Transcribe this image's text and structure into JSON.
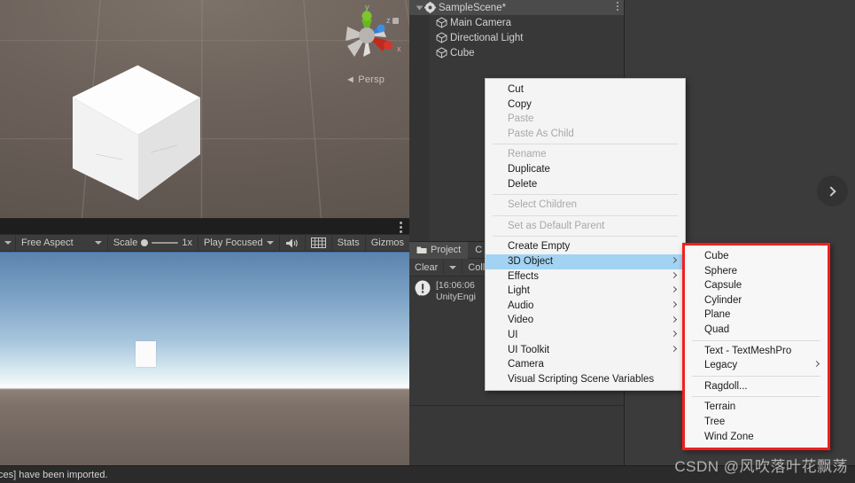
{
  "scene_view": {
    "gizmo_label": "Persp",
    "axis_x": "x",
    "axis_y": "y",
    "axis_z": "z",
    "object_name": "Cube"
  },
  "game_toolbar": {
    "aspect": "Free Aspect",
    "scale_label": "Scale",
    "scale_value": "1x",
    "play_mode": "Play Focused",
    "stats": "Stats",
    "gizmos": "Gizmos",
    "mute_icon": "speaker-icon",
    "gizmo_icon": "grid-icon",
    "menu_icon": "kebab-icon"
  },
  "hierarchy": {
    "scene_name": "SampleScene*",
    "items": [
      {
        "label": "Main Camera",
        "icon": "gameobject-icon"
      },
      {
        "label": "Directional Light",
        "icon": "gameobject-icon"
      },
      {
        "label": "Cube",
        "icon": "gameobject-icon"
      }
    ]
  },
  "project_panel": {
    "tabs": [
      {
        "label": "Project",
        "icon": "folder-icon",
        "active": true
      },
      {
        "label": "C",
        "icon": "console-icon",
        "active": false
      }
    ],
    "console_buttons": [
      "Clear",
      "Collapse"
    ],
    "log": {
      "timestamp": "[16:06:06",
      "message": "UnityEngi"
    }
  },
  "inspector": {
    "collapse_icon": "chevron-right-icon"
  },
  "context_menu": {
    "items": [
      {
        "label": "Cut",
        "disabled": false,
        "submenu": false
      },
      {
        "label": "Copy",
        "disabled": false,
        "submenu": false
      },
      {
        "label": "Paste",
        "disabled": true,
        "submenu": false
      },
      {
        "label": "Paste As Child",
        "disabled": true,
        "submenu": false
      },
      {
        "sep": true
      },
      {
        "label": "Rename",
        "disabled": true,
        "submenu": false
      },
      {
        "label": "Duplicate",
        "disabled": false,
        "submenu": false
      },
      {
        "label": "Delete",
        "disabled": false,
        "submenu": false
      },
      {
        "sep": true
      },
      {
        "label": "Select Children",
        "disabled": true,
        "submenu": false
      },
      {
        "sep": true
      },
      {
        "label": "Set as Default Parent",
        "disabled": true,
        "submenu": false
      },
      {
        "sep": true
      },
      {
        "label": "Create Empty",
        "disabled": false,
        "submenu": false
      },
      {
        "label": "3D Object",
        "disabled": false,
        "submenu": true,
        "selected": true
      },
      {
        "label": "Effects",
        "disabled": false,
        "submenu": true
      },
      {
        "label": "Light",
        "disabled": false,
        "submenu": true
      },
      {
        "label": "Audio",
        "disabled": false,
        "submenu": true
      },
      {
        "label": "Video",
        "disabled": false,
        "submenu": true
      },
      {
        "label": "UI",
        "disabled": false,
        "submenu": true
      },
      {
        "label": "UI Toolkit",
        "disabled": false,
        "submenu": true
      },
      {
        "label": "Camera",
        "disabled": false,
        "submenu": false
      },
      {
        "label": "Visual Scripting Scene Variables",
        "disabled": false,
        "submenu": false
      }
    ]
  },
  "submenu_3d_object": {
    "highlight_color": "#f21f1f",
    "items": [
      {
        "label": "Cube",
        "submenu": false
      },
      {
        "label": "Sphere",
        "submenu": false
      },
      {
        "label": "Capsule",
        "submenu": false
      },
      {
        "label": "Cylinder",
        "submenu": false
      },
      {
        "label": "Plane",
        "submenu": false
      },
      {
        "label": "Quad",
        "submenu": false
      },
      {
        "sep": true
      },
      {
        "label": "Text - TextMeshPro",
        "submenu": false
      },
      {
        "label": "Legacy",
        "submenu": true
      },
      {
        "sep": true
      },
      {
        "label": "Ragdoll...",
        "submenu": false
      },
      {
        "sep": true
      },
      {
        "label": "Terrain",
        "submenu": false
      },
      {
        "label": "Tree",
        "submenu": false
      },
      {
        "label": "Wind Zone",
        "submenu": false
      }
    ]
  },
  "status_bar": {
    "message": "ces] have been imported."
  },
  "watermark": {
    "text": "CSDN @风吹落叶花飘荡"
  }
}
